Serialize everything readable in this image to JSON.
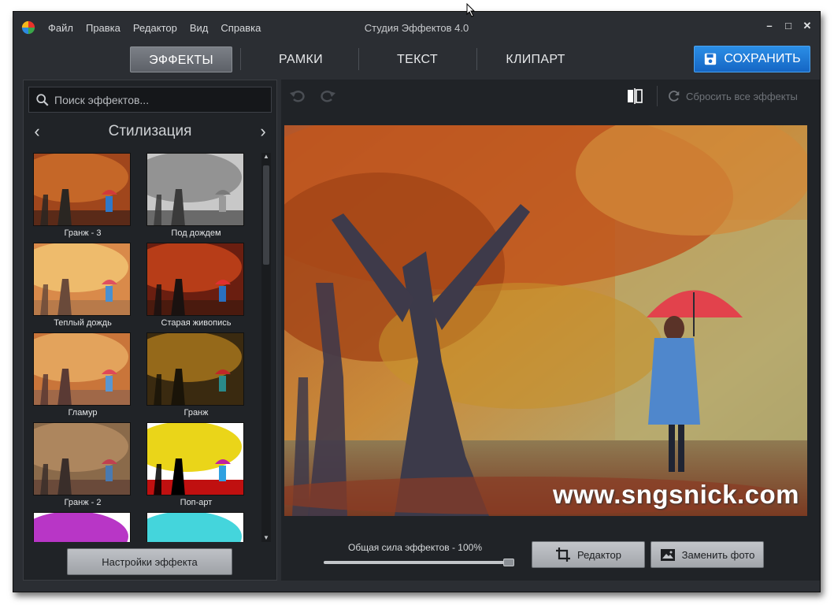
{
  "titlebar": {
    "menu": [
      "Файл",
      "Правка",
      "Редактор",
      "Вид",
      "Справка"
    ],
    "title": "Студия Эффектов 4.0",
    "minimize": "–",
    "maximize": "□",
    "close": "✕"
  },
  "tabs": [
    {
      "label": "ЭФФЕКТЫ",
      "active": true
    },
    {
      "label": "РАМКИ",
      "active": false
    },
    {
      "label": "ТЕКСТ",
      "active": false
    },
    {
      "label": "КЛИПАРТ",
      "active": false
    }
  ],
  "save_button": "СОХРАНИТЬ",
  "effects_panel": {
    "search_placeholder": "Поиск эффектов...",
    "category": "Стилизация",
    "prev": "‹",
    "next": "›",
    "effects": [
      {
        "label": "Гранж - 3",
        "style": "grunge3"
      },
      {
        "label": "Под дождем",
        "style": "rain"
      },
      {
        "label": "Теплый дождь",
        "style": "warm"
      },
      {
        "label": "Старая живопись",
        "style": "oldpaint"
      },
      {
        "label": "Гламур",
        "style": "glamour"
      },
      {
        "label": "Гранж",
        "style": "grunge"
      },
      {
        "label": "Гранж - 2",
        "style": "grunge2"
      },
      {
        "label": "Поп-арт",
        "style": "popart"
      },
      {
        "label": "",
        "style": "purple"
      },
      {
        "label": "",
        "style": "cyan"
      }
    ],
    "settings_button": "Настройки эффекта"
  },
  "preview": {
    "reset_label": "Сбросить все эффекты",
    "watermark": "www.sngsnick.com",
    "strength_label": "Общая сила эффектов - 100%",
    "strength_value": 1.0,
    "editor_button": "Редактор",
    "replace_button": "Заменить фото"
  },
  "colors": {
    "accent": "#1e78d6",
    "background": "#2b2e33",
    "panel": "#202327"
  }
}
